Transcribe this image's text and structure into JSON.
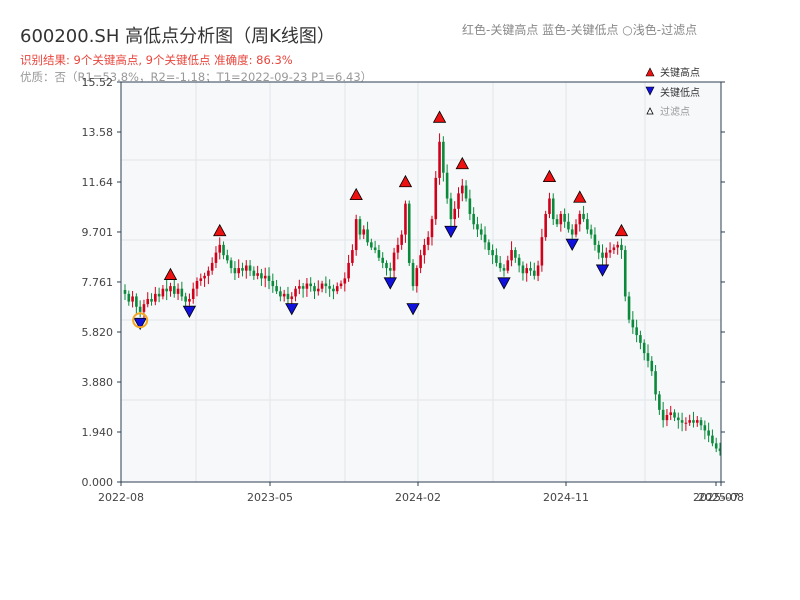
{
  "title": "600200.SH 高低点分析图（周K线图）",
  "subtitle": "识别结果: 9个关键高点, 9个关键低点  准确度: 86.3%",
  "quality": "优质：否（R1=53.8%，R2=-1.18；T1=2022-09-23 P1=6.43）",
  "color_note": "红色-关键高点     蓝色-关键低点  ○浅色-过滤点",
  "legend": {
    "high": "关键高点",
    "low": "关键低点",
    "filtered": "过滤点"
  },
  "colors": {
    "up": "#d0021b",
    "down": "#0b8a3c",
    "high_marker": "#ee1111",
    "low_marker": "#1111dd",
    "highlight": "#f5a623"
  },
  "chart_data": {
    "type": "candlestick",
    "ylim": [
      0,
      15.52
    ],
    "yticks": [
      "0.000",
      "1.940",
      "3.880",
      "5.820",
      "7.761",
      "9.701",
      "11.64",
      "13.58",
      "15.52"
    ],
    "xticks": [
      "2022-08",
      "2023-05",
      "2024-02",
      "2024-11",
      "2025-07",
      "2025-08"
    ],
    "start_week": "2022-08-26",
    "closes": [
      7.3,
      7.0,
      7.2,
      6.8,
      6.6,
      6.9,
      7.1,
      7.0,
      7.3,
      7.2,
      7.5,
      7.4,
      7.6,
      7.3,
      7.5,
      7.2,
      7.0,
      7.1,
      7.5,
      7.8,
      7.9,
      8.0,
      8.2,
      8.5,
      8.9,
      9.2,
      8.8,
      8.6,
      8.3,
      8.1,
      8.3,
      8.2,
      8.4,
      8.2,
      8.0,
      8.1,
      7.9,
      8.0,
      7.8,
      7.6,
      7.4,
      7.2,
      7.3,
      7.1,
      7.2,
      7.5,
      7.6,
      7.5,
      7.7,
      7.6,
      7.4,
      7.5,
      7.7,
      7.6,
      7.5,
      7.4,
      7.6,
      7.7,
      7.9,
      8.5,
      9.0,
      10.2,
      9.6,
      9.8,
      9.3,
      9.1,
      9.0,
      8.7,
      8.5,
      8.3,
      8.2,
      8.9,
      9.2,
      9.6,
      10.8,
      8.5,
      7.6,
      8.3,
      8.8,
      9.2,
      9.5,
      10.2,
      11.8,
      13.2,
      12.0,
      11.0,
      10.2,
      10.6,
      11.2,
      11.5,
      11.0,
      10.4,
      10.0,
      9.8,
      9.6,
      9.3,
      9.0,
      8.8,
      8.5,
      8.3,
      8.2,
      8.6,
      9.0,
      8.7,
      8.4,
      8.1,
      8.3,
      8.2,
      8.0,
      8.4,
      9.5,
      10.4,
      11.0,
      10.2,
      10.0,
      10.4,
      10.1,
      9.8,
      9.6,
      10.0,
      10.4,
      10.2,
      9.8,
      9.6,
      9.2,
      8.9,
      8.7,
      8.9,
      9.0,
      9.1,
      9.2,
      9.0,
      7.2,
      6.3,
      6.0,
      5.7,
      5.4,
      5.0,
      4.7,
      4.3,
      3.4,
      2.8,
      2.4,
      2.6,
      2.7,
      2.5,
      2.4,
      2.3,
      2.3,
      2.4,
      2.3,
      2.4,
      2.2,
      2.0,
      1.8,
      1.5,
      1.3,
      1.2
    ],
    "key_highs": [
      {
        "week": 12,
        "price": 7.7
      },
      {
        "week": 25,
        "price": 9.4
      },
      {
        "week": 61,
        "price": 10.8
      },
      {
        "week": 74,
        "price": 11.3
      },
      {
        "week": 83,
        "price": 13.8
      },
      {
        "week": 89,
        "price": 12.0
      },
      {
        "week": 112,
        "price": 11.5
      },
      {
        "week": 120,
        "price": 10.7
      },
      {
        "week": 131,
        "price": 9.4
      }
    ],
    "key_lows": [
      {
        "week": 4,
        "price": 6.43
      },
      {
        "week": 17,
        "price": 6.9
      },
      {
        "week": 44,
        "price": 7.0
      },
      {
        "week": 70,
        "price": 8.0
      },
      {
        "week": 76,
        "price": 7.0
      },
      {
        "week": 86,
        "price": 10.0
      },
      {
        "week": 100,
        "price": 8.0
      },
      {
        "week": 118,
        "price": 9.5
      },
      {
        "week": 126,
        "price": 8.5
      }
    ],
    "highlighted_point": {
      "date": "2022-09-23",
      "price": 6.43
    }
  }
}
